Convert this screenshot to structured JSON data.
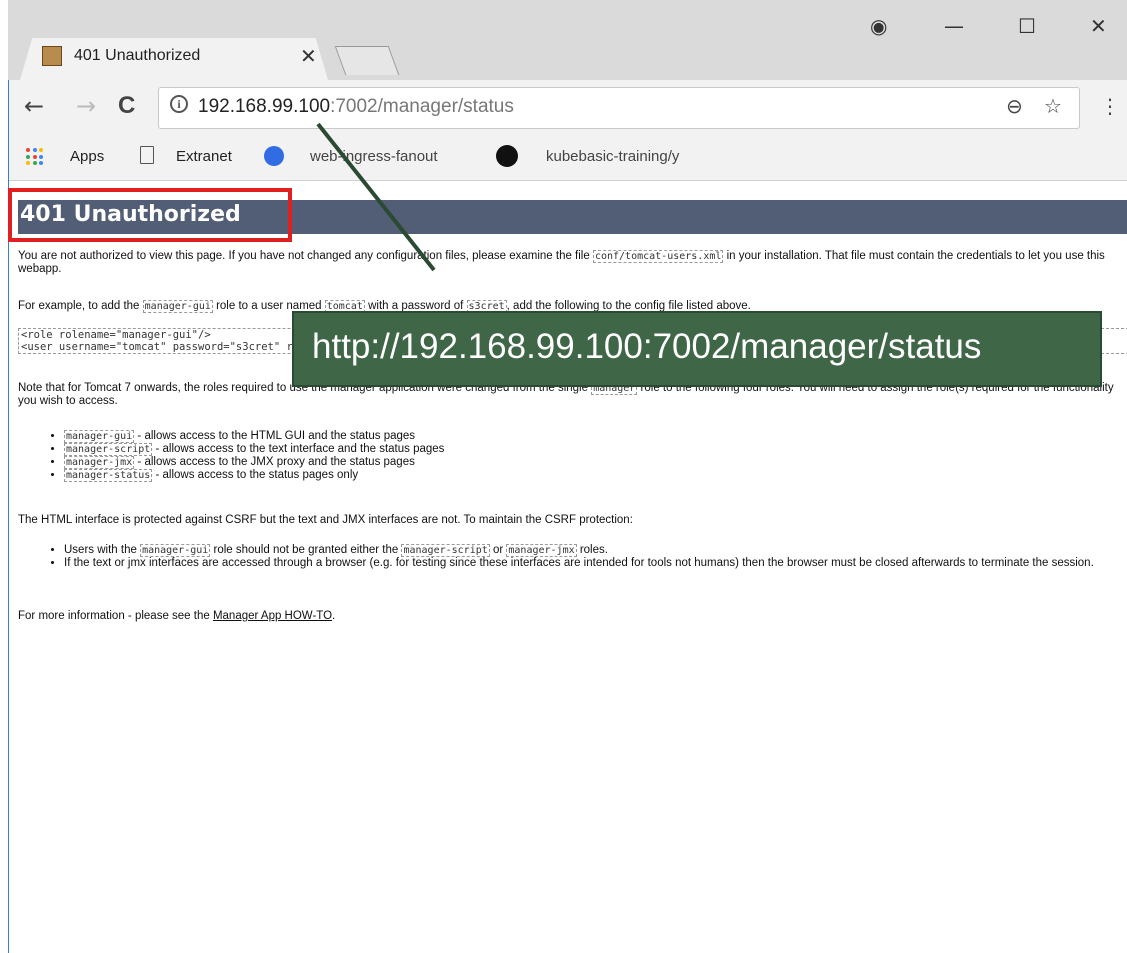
{
  "browser": {
    "tab": {
      "title": "401 Unauthorized",
      "close_glyph": "✕"
    },
    "window_controls": {
      "account_glyph": "◉",
      "minimize_glyph": "—",
      "maximize_glyph": "☐",
      "close_glyph": "✕"
    },
    "toolbar": {
      "back_glyph": "←",
      "forward_glyph": "→",
      "reload_glyph": "C",
      "info_glyph": "i",
      "zoom_glyph": "⊖",
      "star_glyph": "☆",
      "menu_glyph": "⋮"
    },
    "address": {
      "host": "192.168.99.100",
      "rest": ":7002/manager/status"
    },
    "bookmarks": {
      "apps": "Apps",
      "extranet": "Extranet",
      "web_ingress": "web-ingress-fanout",
      "kubebasic": "kubebasic-training/y"
    }
  },
  "page": {
    "heading": "401 Unauthorized",
    "p1_a": "You are not authorized to view this page. If you have not changed any configuration files, please examine the file ",
    "p1_code": "conf/tomcat-users.xml",
    "p1_b": " in your installation. That file must contain the credentials to let you use this webapp.",
    "p2_a": "For example, to add the ",
    "p2_code1": "manager-gui",
    "p2_b": " role to a user named ",
    "p2_code2": "tomcat",
    "p2_c": " with a password of ",
    "p2_code3": "s3cret",
    "p2_d": ", add the following to the config file listed above.",
    "pre_line1": "<role rolename=\"manager-gui\"/>",
    "pre_line2": "<user username=\"tomcat\" password=\"s3cret\" roles=\"manager-gui\"/>",
    "p3_a": "Note that for Tomcat 7 onwards, the roles required to use the manager application were changed from the single ",
    "p3_code": "manager",
    "p3_b": " role to the following four roles. You will need to assign the role(s) required for the functionality you wish to access.",
    "roles": [
      {
        "code": "manager-gui",
        "text": " - allows access to the HTML GUI and the status pages"
      },
      {
        "code": "manager-script",
        "text": " - allows access to the text interface and the status pages"
      },
      {
        "code": "manager-jmx",
        "text": " - allows access to the JMX proxy and the status pages"
      },
      {
        "code": "manager-status",
        "text": " - allows access to the status pages only"
      }
    ],
    "p4": "The HTML interface is protected against CSRF but the text and JMX interfaces are not. To maintain the CSRF protection:",
    "csrf1_a": "Users with the ",
    "csrf1_code1": "manager-gui",
    "csrf1_b": " role should not be granted either the ",
    "csrf1_code2": "manager-script",
    "csrf1_c": " or ",
    "csrf1_code3": "manager-jmx",
    "csrf1_d": " roles.",
    "csrf2": "If the text or jmx interfaces are accessed through a browser (e.g. for testing since these interfaces are intended for tools not humans) then the browser must be closed afterwards to terminate the session.",
    "p5_a": "For more information - please see the ",
    "p5_link": "Manager App HOW-TO",
    "p5_b": "."
  },
  "annotation": {
    "callout_text": "http://192.168.99.100:7002/manager/status",
    "callout_color": "#3e6647",
    "highlight_color": "#e02020"
  }
}
